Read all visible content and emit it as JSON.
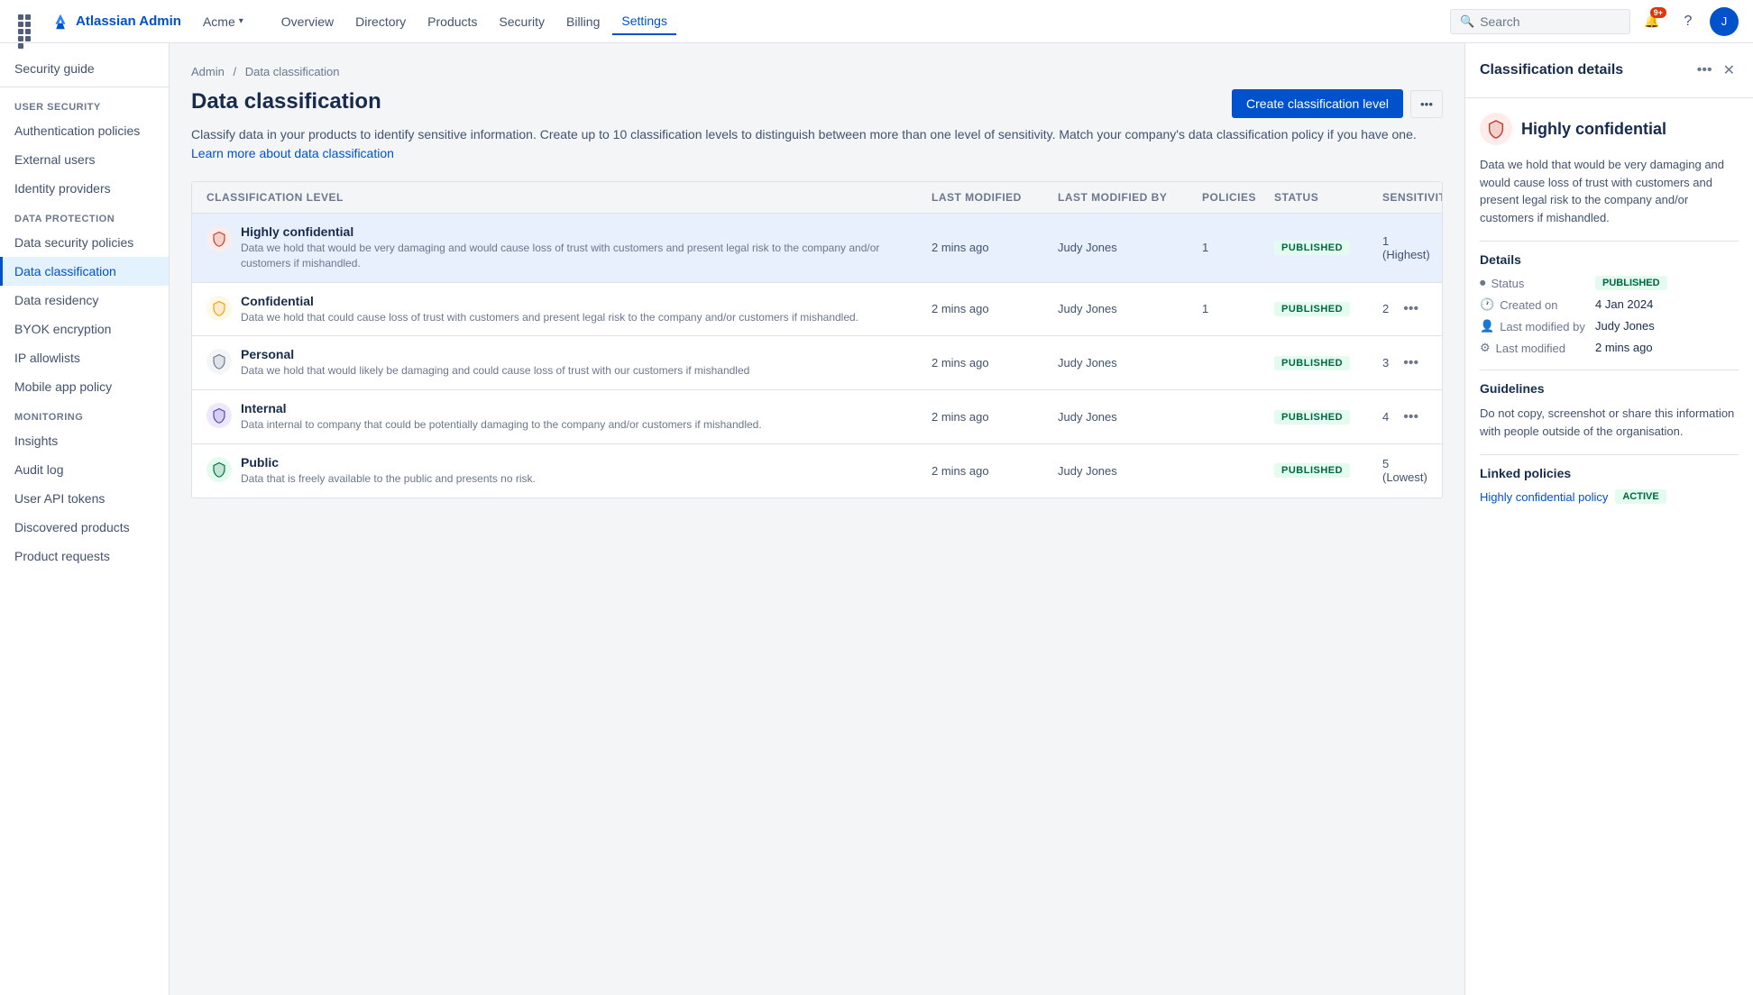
{
  "app": {
    "logo_text": "Atlassian Admin"
  },
  "topnav": {
    "org": "Acme",
    "links": [
      "Overview",
      "Directory",
      "Products",
      "Security",
      "Billing",
      "Settings"
    ],
    "active_link": "Overview",
    "search_placeholder": "Search",
    "notification_count": "9+"
  },
  "breadcrumb": {
    "items": [
      "Admin",
      "Data classification"
    ]
  },
  "page": {
    "title": "Data classification",
    "description": "Classify data in your products to identify sensitive information. Create up to 10 classification levels to distinguish between more than one level of sensitivity. Match your company's data classification policy if you have one.",
    "link_text": "Learn more about data classification",
    "create_button": "Create classification level"
  },
  "table": {
    "columns": [
      "Classification level",
      "Last modified",
      "Last modified by",
      "Policies",
      "Status",
      "Sensitivity"
    ],
    "rows": [
      {
        "name": "Highly confidential",
        "desc": "Data we hold that would be very damaging and would cause loss of trust with customers and present legal risk to the company and/or customers if mishandled.",
        "last_modified": "2 mins ago",
        "modified_by": "Judy Jones",
        "policies": "1",
        "status": "PUBLISHED",
        "sensitivity": "1 (Highest)",
        "icon_color": "#c0392b",
        "icon_bg": "#fdecea",
        "selected": true
      },
      {
        "name": "Confidential",
        "desc": "Data we hold that could cause loss of trust with customers and present legal risk to the company and/or customers if mishandled.",
        "last_modified": "2 mins ago",
        "modified_by": "Judy Jones",
        "policies": "1",
        "status": "PUBLISHED",
        "sensitivity": "2",
        "icon_color": "#f39c12",
        "icon_bg": "#fef9e7",
        "selected": false
      },
      {
        "name": "Personal",
        "desc": "Data we hold that would likely be damaging and could cause loss of trust with our customers if mishandled",
        "last_modified": "2 mins ago",
        "modified_by": "Judy Jones",
        "policies": "",
        "status": "PUBLISHED",
        "sensitivity": "3",
        "icon_color": "#6b778c",
        "icon_bg": "#f4f5f7",
        "selected": false
      },
      {
        "name": "Internal",
        "desc": "Data internal to company that could be potentially damaging to the company and/or customers if mishandled.",
        "last_modified": "2 mins ago",
        "modified_by": "Judy Jones",
        "policies": "",
        "status": "PUBLISHED",
        "sensitivity": "4",
        "icon_color": "#5243aa",
        "icon_bg": "#ede8fe",
        "selected": false
      },
      {
        "name": "Public",
        "desc": "Data that is freely available to the public and presents no risk.",
        "last_modified": "2 mins ago",
        "modified_by": "Judy Jones",
        "policies": "",
        "status": "PUBLISHED",
        "sensitivity": "5 (Lowest)",
        "icon_color": "#006644",
        "icon_bg": "#e3fcef",
        "selected": false
      }
    ]
  },
  "sidebar": {
    "top_item": "Security guide",
    "sections": [
      {
        "label": "USER SECURITY",
        "items": [
          "Authentication policies",
          "External users",
          "Identity providers"
        ]
      },
      {
        "label": "DATA PROTECTION",
        "items": [
          "Data security policies",
          "Data classification",
          "Data residency",
          "BYOK encryption",
          "IP allowlists",
          "Mobile app policy"
        ]
      },
      {
        "label": "MONITORING",
        "items": [
          "Insights",
          "Audit log",
          "User API tokens",
          "Discovered products",
          "Product requests"
        ]
      }
    ]
  },
  "detail_panel": {
    "title": "Classification details",
    "level_name": "Highly confidential",
    "level_description": "Data we hold that would be very damaging and would cause loss of trust with customers and present legal risk to the company and/or customers if mishandled.",
    "details_label": "Details",
    "status_label": "Status",
    "status_value": "PUBLISHED",
    "created_on_label": "Created on",
    "created_on_value": "4 Jan 2024",
    "last_modified_by_label": "Last modified by",
    "last_modified_by_value": "Judy Jones",
    "last_modified_label": "Last modified",
    "last_modified_value": "2 mins ago",
    "guidelines_label": "Guidelines",
    "guidelines_text": "Do not copy, screenshot or share this information with people outside of the organisation.",
    "linked_policies_label": "Linked policies",
    "linked_policy_name": "Highly confidential policy",
    "linked_policy_status": "ACTIVE",
    "icon_color": "#c0392b",
    "icon_bg": "#fdecea"
  }
}
